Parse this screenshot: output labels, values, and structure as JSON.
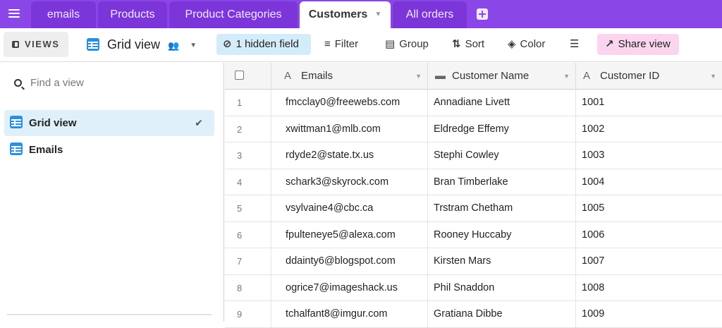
{
  "tabs": [
    {
      "label": "emails",
      "active": false
    },
    {
      "label": "Products",
      "active": false
    },
    {
      "label": "Product Categories",
      "active": false
    },
    {
      "label": "Customers",
      "active": true
    },
    {
      "label": "All orders",
      "active": false
    }
  ],
  "toolbar": {
    "views_label": "VIEWS",
    "current_view": "Grid view",
    "hidden_fields_label": "1 hidden field",
    "filter_label": "Filter",
    "group_label": "Group",
    "sort_label": "Sort",
    "color_label": "Color",
    "share_label": "Share view"
  },
  "sidebar": {
    "search_placeholder": "Find a view",
    "views": [
      {
        "label": "Grid view",
        "selected": true
      },
      {
        "label": "Emails",
        "selected": false
      }
    ]
  },
  "grid": {
    "columns": [
      {
        "label": "Emails",
        "type_icon": "text-type-icon"
      },
      {
        "label": "Customer Name",
        "type_icon": "long-text-type-icon"
      },
      {
        "label": "Customer ID",
        "type_icon": "text-type-icon"
      }
    ],
    "rows": [
      {
        "num": "1",
        "email": "fmcclay0@freewebs.com",
        "name": "Annadiane Livett",
        "id": "1001"
      },
      {
        "num": "2",
        "email": "xwittman1@mlb.com",
        "name": "Eldredge Effemy",
        "id": "1002"
      },
      {
        "num": "3",
        "email": "rdyde2@state.tx.us",
        "name": "Stephi Cowley",
        "id": "1003"
      },
      {
        "num": "4",
        "email": "schark3@skyrock.com",
        "name": "Bran Timberlake",
        "id": "1004"
      },
      {
        "num": "5",
        "email": "vsylvaine4@cbc.ca",
        "name": "Trstram Chetham",
        "id": "1005"
      },
      {
        "num": "6",
        "email": "fpulteneye5@alexa.com",
        "name": "Rooney Huccaby",
        "id": "1006"
      },
      {
        "num": "7",
        "email": "ddainty6@blogspot.com",
        "name": "Kirsten Mars",
        "id": "1007"
      },
      {
        "num": "8",
        "email": "ogrice7@imageshack.us",
        "name": "Phil Snaddon",
        "id": "1008"
      },
      {
        "num": "9",
        "email": "tchalfant8@imgur.com",
        "name": "Gratiana Dibbe",
        "id": "1009"
      }
    ]
  },
  "colors": {
    "tab_bar": "#8b46e8",
    "tab_inactive": "#7c35d9",
    "hidden_field_bg": "#d3ecfa",
    "share_bg": "#fbd5f0",
    "grid_icon": "#2d8fdc",
    "selected_view_bg": "#dff0fa"
  }
}
